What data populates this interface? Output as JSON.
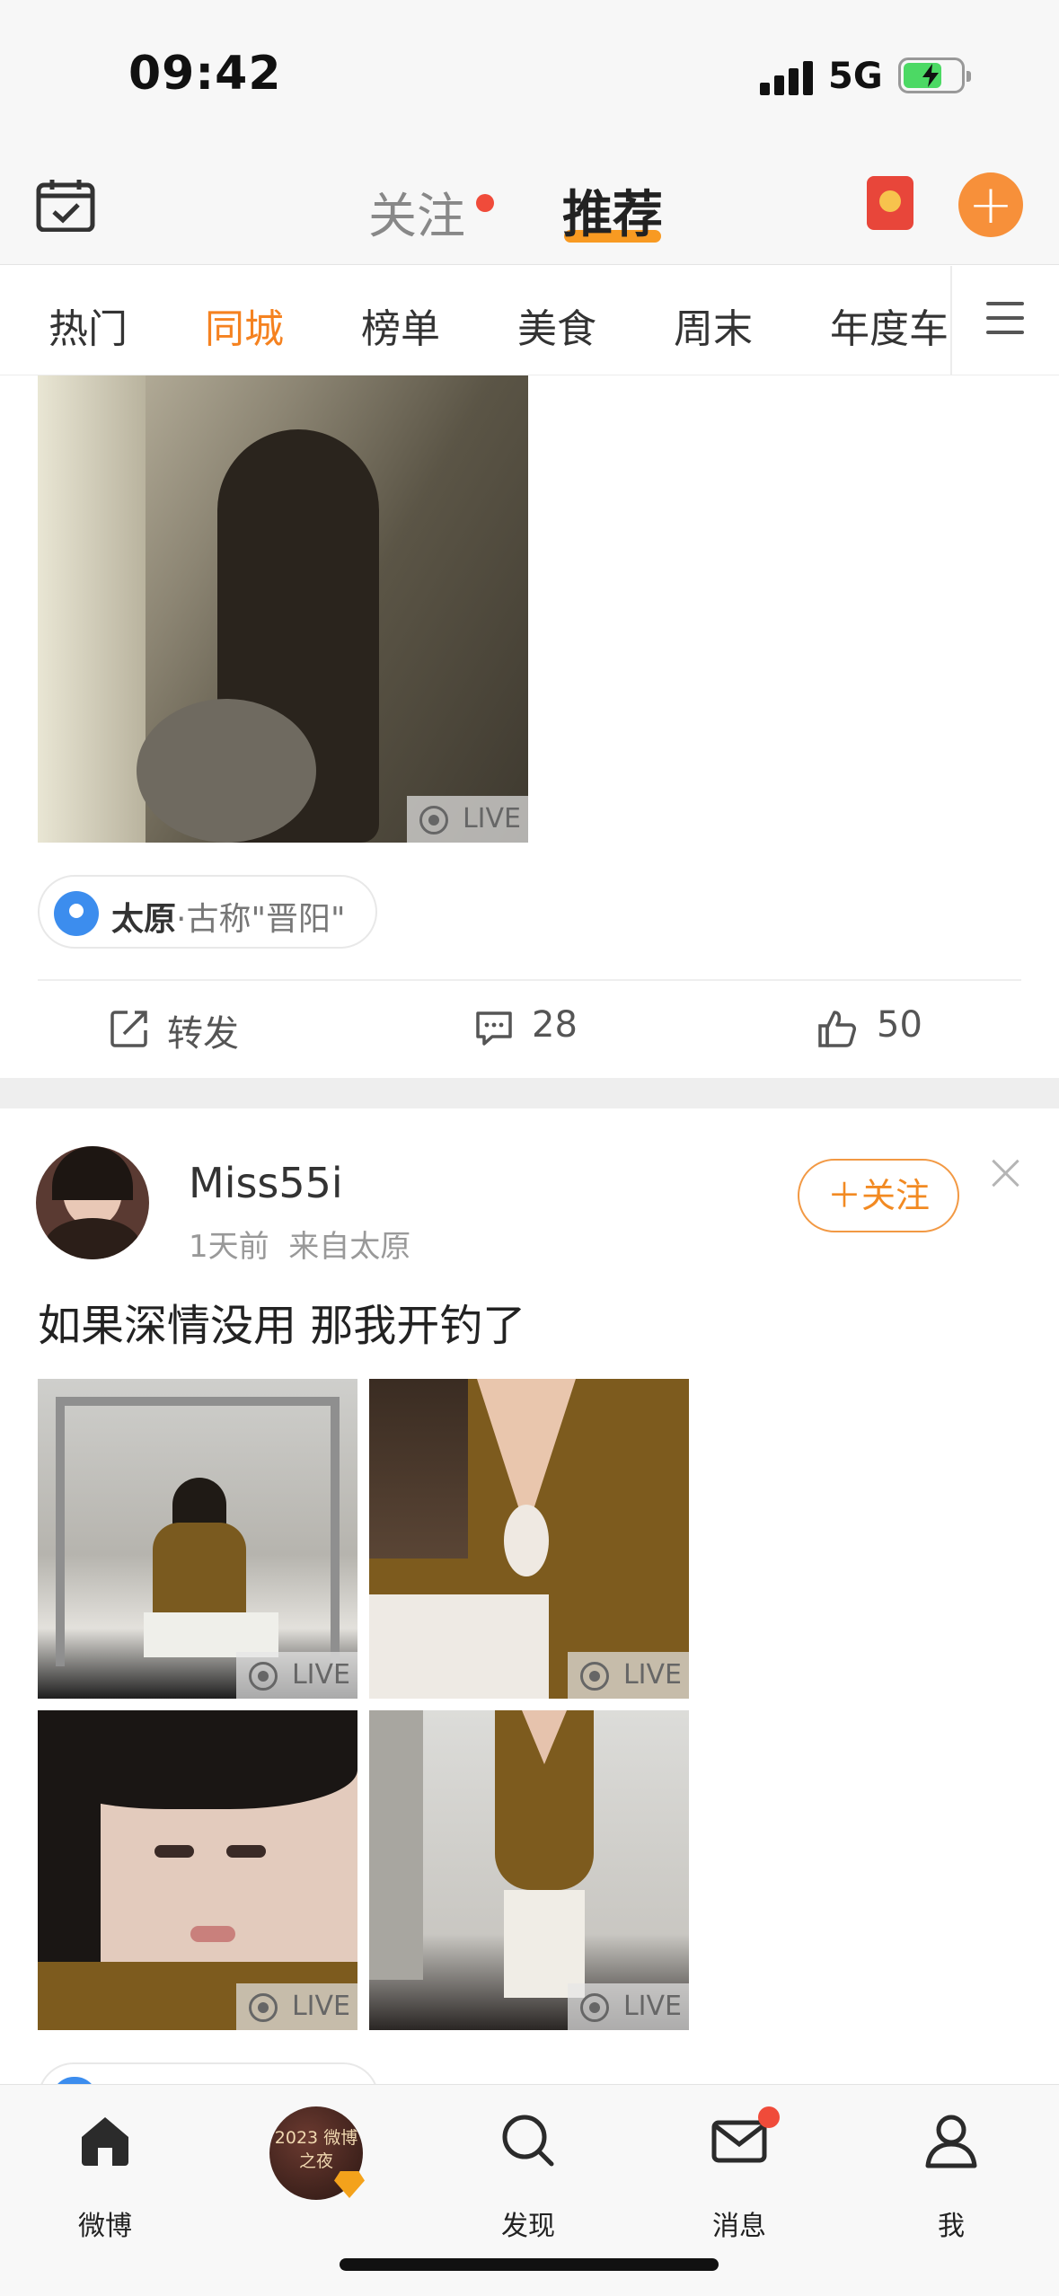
{
  "status_bar": {
    "time": "09:42",
    "network": "5G"
  },
  "top_nav": {
    "tabs": [
      {
        "label": "关注",
        "has_dot": true
      },
      {
        "label": "推荐",
        "active": true
      }
    ],
    "accent_color": "#f89a22"
  },
  "categories": {
    "items": [
      "热门",
      "同城",
      "榜单",
      "美食",
      "周末",
      "年度车"
    ],
    "active": "同城",
    "active_color": "#f58220"
  },
  "post1": {
    "photo_badge": "LIVE",
    "location": {
      "city": "太原",
      "separator": "·",
      "description": "古称\"晋阳\""
    },
    "actions": {
      "repost_label": "转发",
      "comment_count": "28",
      "like_count": "50"
    }
  },
  "post2": {
    "username": "Miss55i",
    "time": "1天前",
    "source": "来自太原",
    "follow_label": "＋关注",
    "text": "如果深情没用 那我开钓了",
    "photos": [
      {
        "badge": "LIVE"
      },
      {
        "badge": "LIVE"
      },
      {
        "badge": "LIVE"
      },
      {
        "badge": "LIVE"
      }
    ]
  },
  "tab_bar": {
    "items": [
      {
        "label": "微博",
        "icon": "home-icon"
      },
      {
        "label": "",
        "icon": "weibo-night-2023-badge"
      },
      {
        "label": "发现",
        "icon": "search-icon"
      },
      {
        "label": "消息",
        "icon": "mail-icon",
        "has_dot": true
      },
      {
        "label": "我",
        "icon": "profile-icon"
      }
    ],
    "badge_text": "2023 微博之夜"
  }
}
